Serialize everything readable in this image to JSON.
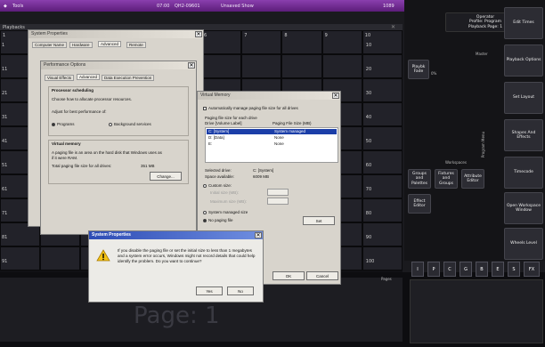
{
  "topbar": {
    "app": "Tools",
    "clock": "07:00",
    "show_id": "QH2-09601",
    "show_name": "Unsaved Show",
    "right_label": "1089"
  },
  "grid": {
    "title": "Playbacks",
    "row_labels": [
      "1",
      "11",
      "21",
      "31",
      "41",
      "51",
      "61",
      "71",
      "81",
      "91"
    ],
    "col_labels": [
      "1",
      "2",
      "3",
      "4",
      "5",
      "6",
      "7",
      "8",
      "9",
      "10"
    ],
    "last_col_labels": [
      "10",
      "20",
      "30",
      "40",
      "50",
      "60",
      "70",
      "80",
      "90",
      "100"
    ]
  },
  "rightpanel": {
    "header": [
      "Operator",
      "Profile: Program",
      "Playback Page: 1"
    ],
    "master_label": "Master",
    "master_button": "Playbk Fade",
    "master_value": "0%",
    "workspaces_label": "Workspaces",
    "workspaces": [
      "Groups and Palettes",
      "Fixtures and Groups",
      "Attribute Editor",
      "Effect Editor"
    ],
    "program_label": "Program Menu",
    "side_buttons": [
      "Edit Times",
      "Playback Options",
      "Set Layout",
      "Shapes And Effects",
      "Timecode",
      "Open Workspace Window",
      "Wheels Level"
    ],
    "pages_label": "Pages",
    "fkeys": [
      "I",
      "P",
      "C",
      "G",
      "B",
      "E",
      "S",
      "FX"
    ]
  },
  "bottom": {
    "page_label": "Page: 1"
  },
  "sysprops_back": {
    "title": "System Properties",
    "tabs": [
      "Computer Name",
      "Hardware",
      "Advanced",
      "Remote"
    ]
  },
  "perf": {
    "title": "Performance Options",
    "tabs": [
      "Visual Effects",
      "Advanced",
      "Data Execution Prevention"
    ],
    "sched_group": "Processor scheduling",
    "sched_desc": "Choose how to allocate processor resources.",
    "adjust": "Adjust for best performance of:",
    "opt_programs": "Programs",
    "opt_bg": "Background services",
    "vm_group": "Virtual memory",
    "vm_desc1": "A paging file is an area on the hard disk that Windows uses as",
    "vm_desc2": "if it were RAM.",
    "vm_total_label": "Total paging file size for all drives:",
    "vm_total": "351 MB",
    "change_btn": "Change..."
  },
  "vm": {
    "title": "Virtual Memory",
    "auto_manage": "Automatically manage paging file size for all drives",
    "paging_group": "Paging file size for each drive",
    "col_drive": "Drive  [Volume Label]",
    "col_size": "Paging File Size (MB)",
    "rows": [
      {
        "drive": "C:   [System]",
        "size": "System managed"
      },
      {
        "drive": "D:   [Data]",
        "size": "None"
      },
      {
        "drive": "E:",
        "size": "None"
      }
    ],
    "selected_drive_label": "Selected drive:",
    "selected_drive": "C:  [System]",
    "space_label": "Space available:",
    "space": "6009 MB",
    "custom": "Custom size:",
    "initial": "Initial size (MB):",
    "maximum": "Maximum size (MB):",
    "system_managed": "System managed size",
    "no_paging": "No paging file",
    "set_btn": "Set",
    "ok_btn": "OK",
    "cancel_btn": "Cancel"
  },
  "alert": {
    "title": "System Properties",
    "message": "If you disable the paging file or set the initial size to less than 1 megabytes and a system error occurs, Windows might not record details that could help identify the problem. Do you want to continue?",
    "yes": "Yes",
    "no": "No"
  }
}
